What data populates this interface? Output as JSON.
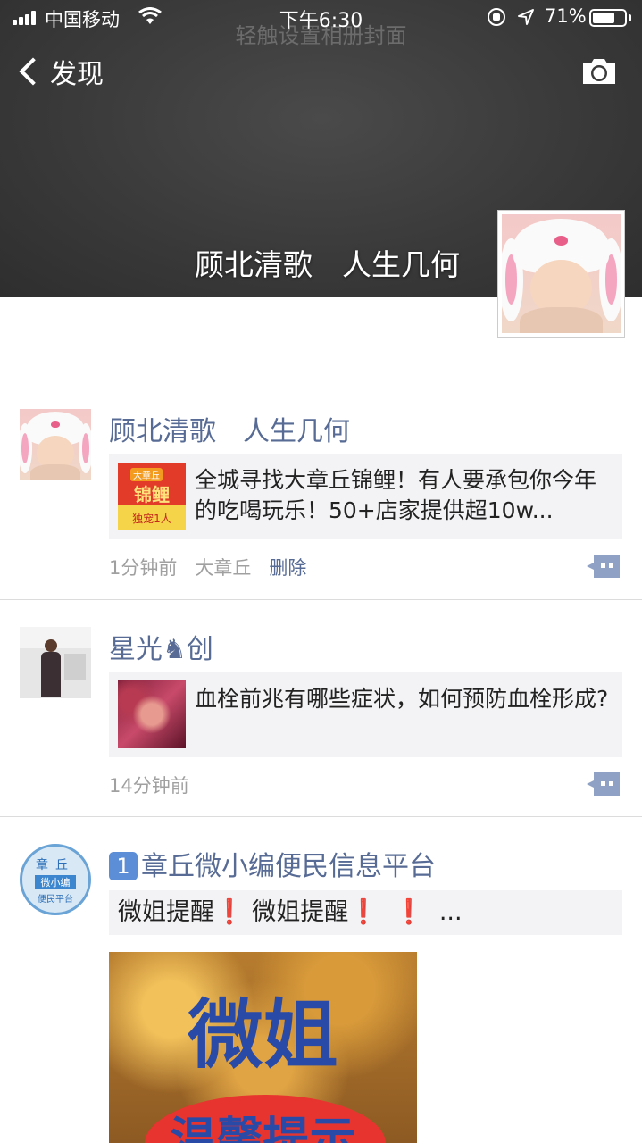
{
  "status_bar": {
    "carrier": "中国移动",
    "time": "下午6:30",
    "battery_percent": "71%",
    "battery_level": 0.71
  },
  "nav": {
    "back_label": "发现"
  },
  "cover": {
    "hint": "轻触设置相册封面",
    "user_name": "顾北清歌　人生几何"
  },
  "posts": [
    {
      "author": "顾北清歌　人生几何",
      "card_text": "全城寻找大章丘锦鲤！有人要承包你今年的吃喝玩乐！50+店家提供超10w...",
      "thumb_caption_top": "大章丘",
      "thumb_caption_mid": "锦鲤",
      "thumb_caption_bottom": "独宠1人",
      "time": "1分钟前",
      "location": "大章丘",
      "delete_label": "删除"
    },
    {
      "author": "星光♞创",
      "card_text": "血栓前兆有哪些症状，如何预防血栓形成?",
      "time": "14分钟前"
    },
    {
      "author_badge": "1",
      "author": "章丘微小编便民信息平台",
      "avatar_text_top": "章丘",
      "avatar_text_mid": "微小编",
      "avatar_text_bottom": "便民平台",
      "text_part1": "微姐提醒",
      "text_part2": "微姐提醒",
      "text_ellipsis": "...",
      "image_title": "微姐",
      "image_subtitle": "温馨提示"
    }
  ],
  "colors": {
    "link_blue": "#576b95",
    "meta_gray": "#a0a0a0",
    "card_bg": "#f3f3f5",
    "alert_red": "#e0242b"
  }
}
